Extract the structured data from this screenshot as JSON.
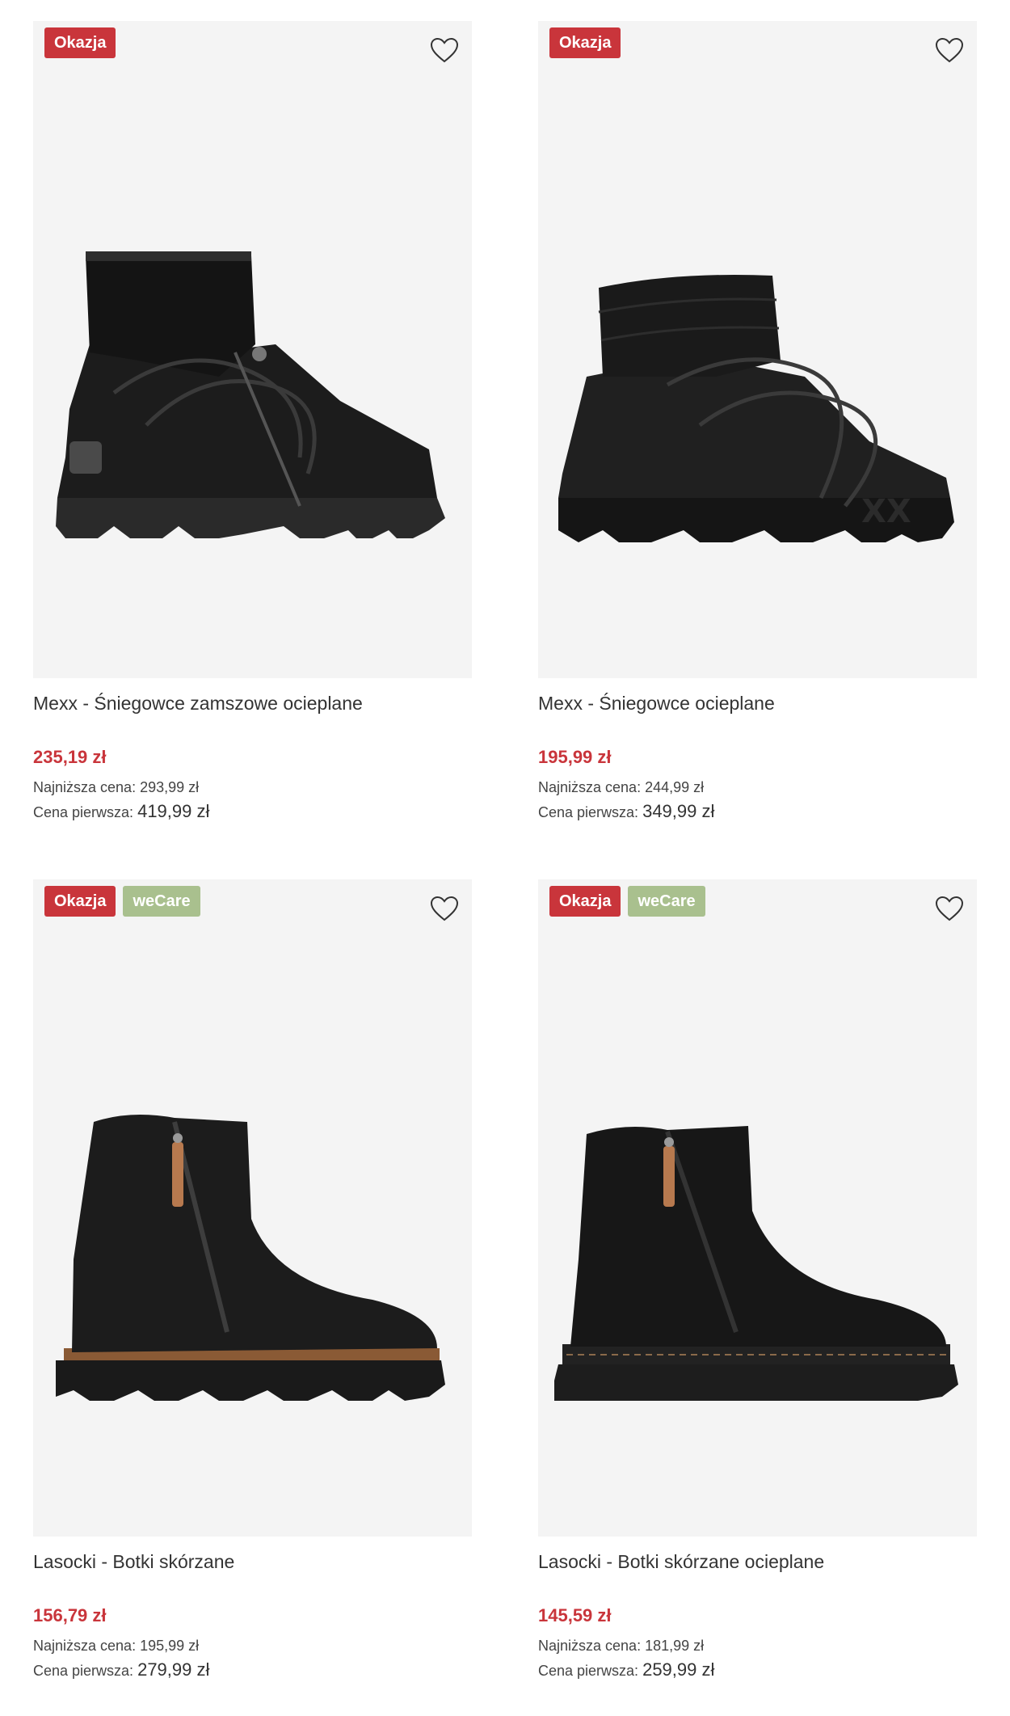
{
  "products": [
    {
      "badges": [
        "Okazja"
      ],
      "title": "Mexx - Śniegowce zamszowe ocieplane",
      "price": "235,19 zł",
      "lowest_label": "Najniższa cena:",
      "lowest_value": "293,99 zł",
      "original_label": "Cena pierwsza:",
      "original_value": "419,99 zł"
    },
    {
      "badges": [
        "Okazja"
      ],
      "title": "Mexx - Śniegowce ocieplane",
      "price": "195,99 zł",
      "lowest_label": "Najniższa cena:",
      "lowest_value": "244,99 zł",
      "original_label": "Cena pierwsza:",
      "original_value": "349,99 zł"
    },
    {
      "badges": [
        "Okazja",
        "weCare"
      ],
      "title": "Lasocki - Botki skórzane",
      "price": "156,79 zł",
      "lowest_label": "Najniższa cena:",
      "lowest_value": "195,99 zł",
      "original_label": "Cena pierwsza:",
      "original_value": "279,99 zł"
    },
    {
      "badges": [
        "Okazja",
        "weCare"
      ],
      "title": "Lasocki - Botki skórzane ocieplane",
      "price": "145,59 zł",
      "lowest_label": "Najniższa cena:",
      "lowest_value": "181,99 zł",
      "original_label": "Cena pierwsza:",
      "original_value": "259,99 zł"
    }
  ],
  "colors": {
    "sale_badge": "#c9353b",
    "wecare_badge": "#a9c08e",
    "price": "#c9353b",
    "image_bg": "#f4f4f4"
  },
  "icons": {
    "wishlist": "heart-outline-icon"
  }
}
